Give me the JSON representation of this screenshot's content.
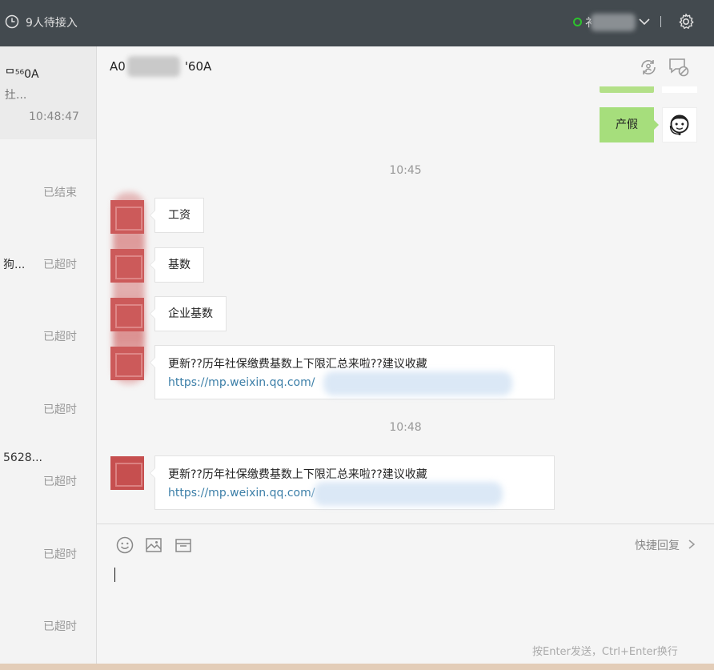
{
  "topbar": {
    "waiting_label": "9人待接入",
    "agent_name_partial": "衤",
    "online_color": "#2dc22d"
  },
  "sidebar": {
    "active_session": {
      "title": "ᄆ⁵⁶0A",
      "preview": "扗...",
      "time": "10:48:47"
    },
    "items": [
      {
        "preview": "",
        "status": "已结束"
      },
      {
        "preview": "狗...",
        "status": "已超时"
      },
      {
        "preview": "",
        "status": "已超时"
      },
      {
        "preview": "",
        "status": "已超时"
      },
      {
        "preview": "5628...",
        "status": "已超时"
      },
      {
        "preview": "",
        "status": "已超时"
      },
      {
        "preview": "",
        "status": "已超时"
      }
    ]
  },
  "chat": {
    "customer_id_start": "A0",
    "customer_id_end": "'60A",
    "messages": {
      "outgoing_1": "产假",
      "time_1": "10:45",
      "in_1": "工资",
      "in_2": "基数",
      "in_3": "企业基数",
      "card_1_title": "更新??历年社保缴费基数上下限汇总来啦??建议收藏",
      "card_1_link": "https://mp.weixin.qq.com/",
      "time_2": "10:48",
      "card_2_title": "更新??历年社保缴费基数上下限汇总来啦??建议收藏",
      "card_2_link": "https://mp.weixin.qq.com/"
    }
  },
  "input": {
    "quick_reply_label": "快捷回复",
    "send_hint": "按Enter发送，Ctrl+Enter换行",
    "tools": [
      "emoji-icon",
      "image-icon",
      "folder-icon"
    ]
  },
  "colors": {
    "topbar_bg": "#434a4f",
    "outgoing_bubble": "#a6de7c",
    "link": "#3c7fa8"
  }
}
